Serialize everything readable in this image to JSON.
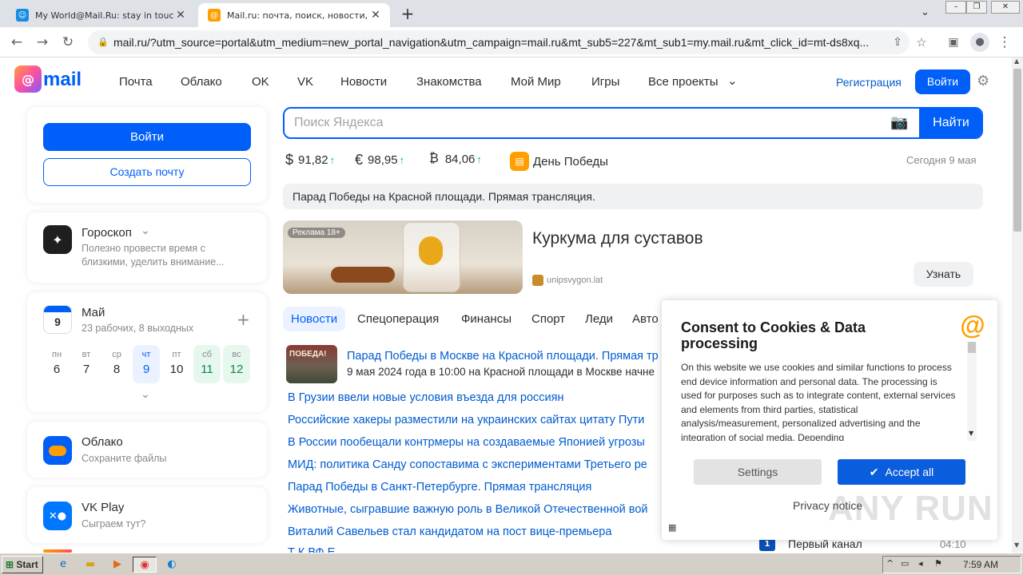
{
  "browser": {
    "tabs": [
      {
        "title": "My World@Mail.Ru: stay in touch wit",
        "favicon": "mymir-icon",
        "active": false
      },
      {
        "title": "Mail.ru: почта, поиск, новости, пр",
        "favicon": "mailru-at-icon",
        "active": true
      }
    ],
    "new_tab": "+",
    "url": "mail.ru/?utm_source=portal&utm_medium=new_portal_navigation&utm_campaign=mail.ru&mt_sub5=227&mt_sub1=my.mail.ru&mt_click_id=mt-ds8xq..."
  },
  "header": {
    "logo_text": "mail",
    "nav": [
      "Почта",
      "Облако",
      "OK",
      "VK",
      "Новости",
      "Знакомства",
      "Мой Мир",
      "Игры",
      "Все проекты"
    ],
    "register_label": "Регистрация",
    "login_label": "Войти"
  },
  "sidebar": {
    "login_button": "Войти",
    "create_mail_button": "Создать почту",
    "horoscope": {
      "title": "Гороскоп",
      "text": "Полезно провести время с близкими, уделить внимание..."
    },
    "calendar": {
      "day_badge": "9",
      "month": "Май",
      "summary": "23 рабочих, 8 выходных",
      "days": [
        {
          "name": "пн",
          "num": "6"
        },
        {
          "name": "вт",
          "num": "7"
        },
        {
          "name": "ср",
          "num": "8"
        },
        {
          "name": "чт",
          "num": "9"
        },
        {
          "name": "пт",
          "num": "10"
        },
        {
          "name": "сб",
          "num": "11"
        },
        {
          "name": "вс",
          "num": "12"
        }
      ]
    },
    "cloud": {
      "title": "Облако",
      "text": "Сохраните файлы"
    },
    "vkplay": {
      "title": "VK Play",
      "text": "Сыграем тут?"
    }
  },
  "search": {
    "placeholder": "Поиск Яндекса",
    "button": "Найти"
  },
  "rates": [
    {
      "symbol": "$",
      "value": "91,82"
    },
    {
      "symbol": "€",
      "value": "98,95"
    },
    {
      "symbol": "₿",
      "value": "84,06"
    }
  ],
  "holiday": "День Победы",
  "today": "Сегодня 9 мая",
  "banner_text": "Парад Победы на Красной площади. Прямая трансляция.",
  "ad": {
    "badge": "Реклама 18+",
    "title": "Куркума для суставов",
    "domain": "unipsvygon.lat",
    "button": "Узнать"
  },
  "news_tabs": [
    "Новости",
    "Спецоперация",
    "Финансы",
    "Спорт",
    "Леди",
    "Авто"
  ],
  "news_top": {
    "title": "Парад Победы в Москве на Красной площади. Прямая тр",
    "text": "9 мая 2024 года в 10:00 на Красной площади в Москве начне",
    "thumb_text": "ПОБЕДА!"
  },
  "news": [
    "В Грузии ввели новые условия въезда для россиян",
    "Российские хакеры разместили на украинских сайтах цитату Пути",
    "В России пообещали контрмеры на создаваемые Японией угрозы",
    "МИД: политика Санду сопоставима с экспериментами Третьего ре",
    "Парад Победы в Санкт-Петербурге. Прямая трансляция",
    "Животные, сыгравшие важную роль в Великой Отечественной вой",
    "Виталий Савельев стал кандидатом на пост вице-премьера",
    "Т К ВФ Е"
  ],
  "tv": {
    "channel": "Первый канал",
    "time": "04:10"
  },
  "consent": {
    "title": "Consent to Cookies & Data processing",
    "body": "On this website we use cookies and similar functions to process end device information and personal data. The processing is used for purposes such as to integrate content, external services and elements from third parties, statistical analysis/measurement, personalized advertising and the integration of social media. Depending",
    "settings": "Settings",
    "accept": "Accept all",
    "privacy": "Privacy notice"
  },
  "watermark": "ANY RUN",
  "taskbar": {
    "start": "Start",
    "clock": "7:59 AM"
  },
  "colors": {
    "brand_blue": "#005ff9",
    "link_blue": "#005bd1",
    "rate_up": "#0dc268",
    "consent_accept": "#0a5ddc",
    "calendar_today_bg": "#ebf2ff",
    "calendar_weekend_bg": "#e6f7ee"
  }
}
